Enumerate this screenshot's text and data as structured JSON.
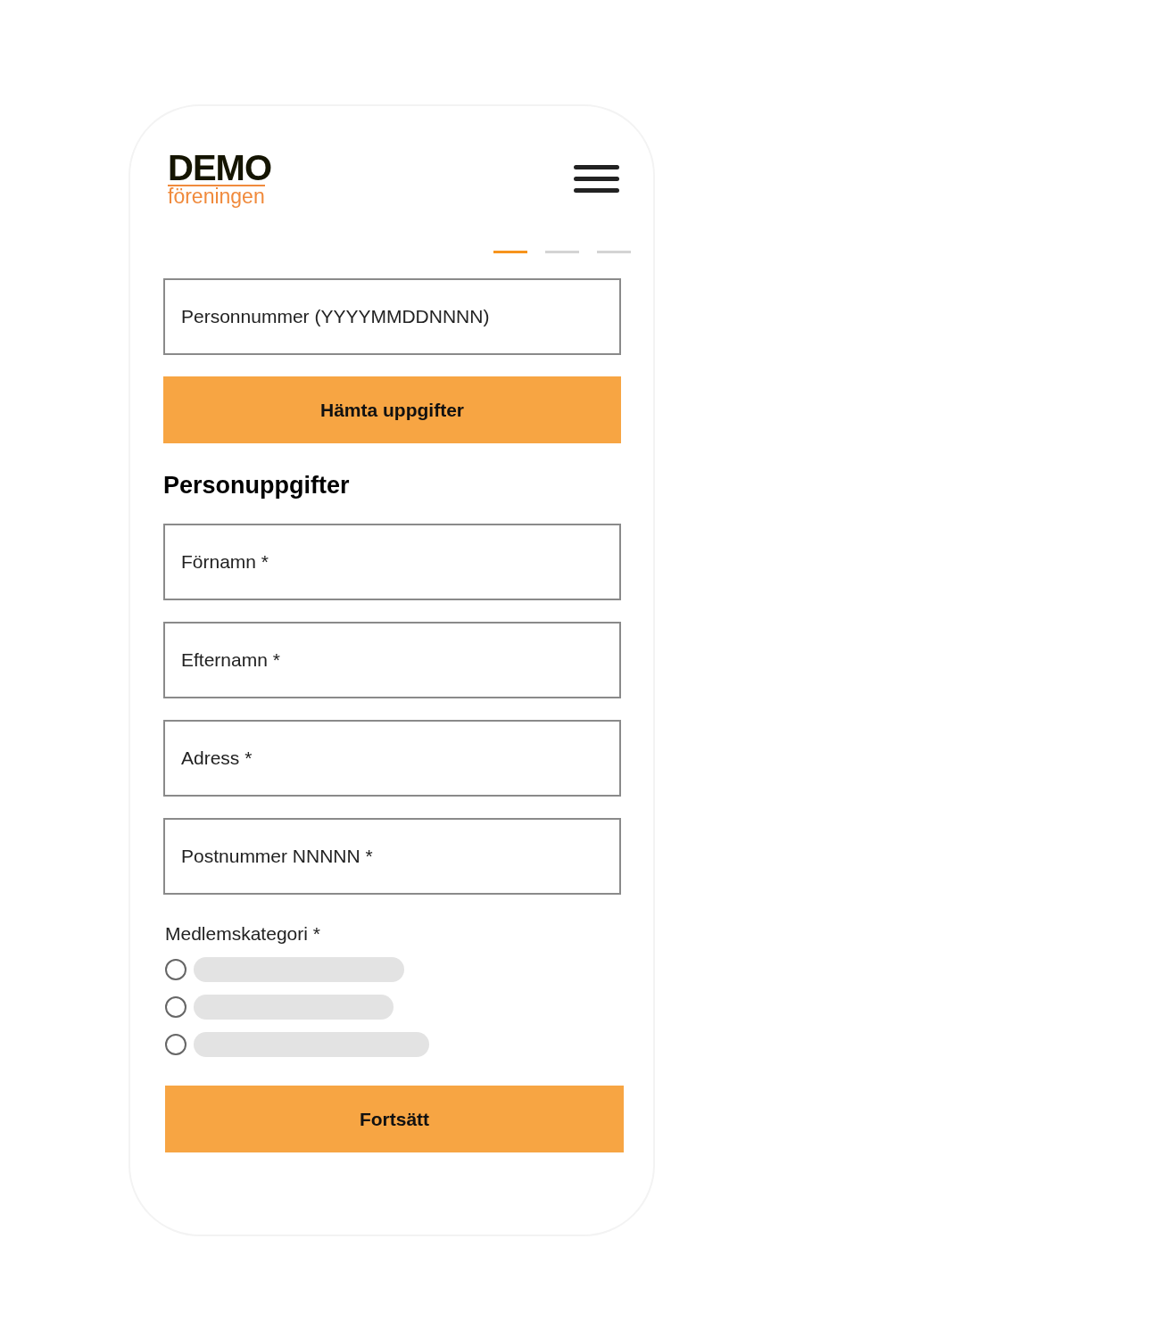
{
  "logo": {
    "title": "DEMO",
    "subtitle": "föreningen"
  },
  "steps": [
    {
      "selected": true
    },
    {
      "selected": false
    },
    {
      "selected": false
    }
  ],
  "lookup": {
    "placeholder": "Personnummer (YYYYMMDDNNNN)",
    "button": "Hämta uppgifter"
  },
  "section_title": "Personuppgifter",
  "fields": [
    {
      "placeholder": "Förnamn *"
    },
    {
      "placeholder": "Efternamn *"
    },
    {
      "placeholder": "Adress *"
    },
    {
      "placeholder": "Postnummer NNNNN *"
    }
  ],
  "category": {
    "label": "Medlemskategori *",
    "options": [
      {
        "selected": false
      },
      {
        "selected": false
      },
      {
        "selected": false
      }
    ]
  },
  "submit": "Fortsätt"
}
